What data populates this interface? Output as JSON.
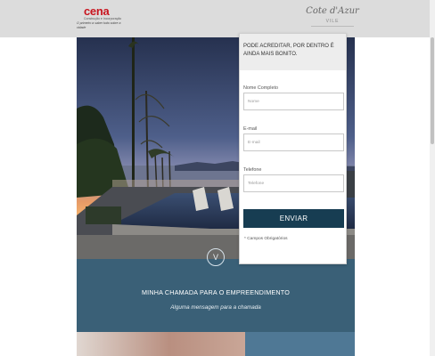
{
  "header": {
    "logo_left_brand": "cena",
    "logo_left_line1": "Construção e Incorporação",
    "logo_left_line2": "O primeiro a saber tudo sobre a cidade",
    "logo_right_script": "Cote d'Azur",
    "logo_right_sub": "VILE"
  },
  "form": {
    "heading": "PODE ACREDITAR, POR DENTRO É AINDA MAIS BONITO.",
    "name_label": "Nome Completo",
    "name_placeholder": "Nome",
    "email_label": "E-mail",
    "email_placeholder": "E-mail",
    "phone_label": "Telefone",
    "phone_placeholder": "Telefone",
    "submit_label": "ENVIAR",
    "required_note": "* Campos Obrigatórios"
  },
  "band": {
    "arrow": "V",
    "title": "MINHA CHAMADA PARA O EMPREENDIMENTO",
    "subtitle": "Alguma mensagem para a chamada"
  },
  "colors": {
    "header_bg": "#dcdcdc",
    "band_bg": "#3a6077",
    "button_bg": "#173d52",
    "brand_red": "#c8141e"
  }
}
